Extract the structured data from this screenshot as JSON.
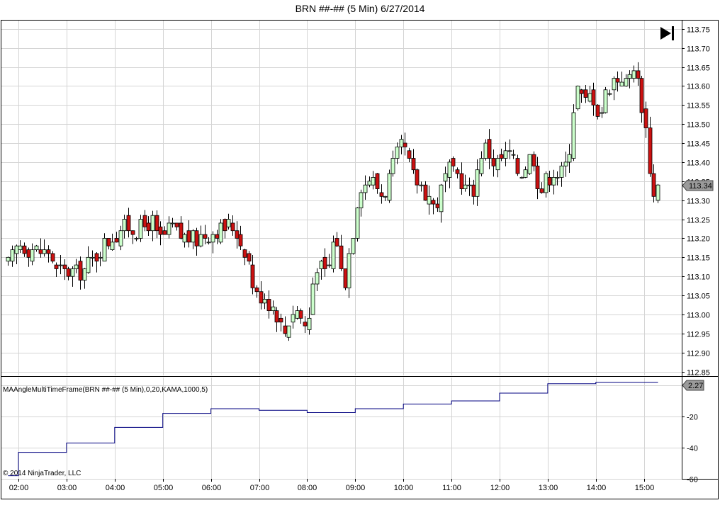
{
  "window": {
    "title": "BRN ##-## (5 Min)  6/27/2014"
  },
  "toolbar": {
    "scroll_to_end_icon": "skip-to-end-icon"
  },
  "indicator": {
    "label": "MAAngleMultiTimeFrame(BRN ##-## (5 Min),0,20,KAMA,1000,5)",
    "current_value_label": "2.27"
  },
  "price_panel": {
    "current_price_label": "113.34"
  },
  "copyright": "© 2014 NinjaTrader, LLC",
  "colors": {
    "up_candle": "#ccffcc",
    "down_candle": "#cc1111",
    "indicator_line": "#000080",
    "grid": "#d4d4d4"
  },
  "chart_data": [
    {
      "type": "candlestick",
      "title": "BRN ##-## (5 Min)  6/27/2014",
      "ylim": [
        112.84,
        113.77
      ],
      "yticks": [
        113.75,
        113.7,
        113.65,
        113.6,
        113.55,
        113.5,
        113.45,
        113.4,
        113.35,
        113.3,
        113.25,
        113.2,
        113.15,
        113.1,
        113.05,
        113.0,
        112.95,
        112.9,
        112.85
      ],
      "x_tick_labels": [
        "02:00",
        "03:00",
        "04:00",
        "05:00",
        "06:00",
        "07:00",
        "08:00",
        "09:00",
        "10:00",
        "11:00",
        "12:00",
        "13:00",
        "14:00",
        "15:00"
      ],
      "last_price": 113.34,
      "grid": true,
      "close_path": [
        [
          "01:47",
          113.13
        ],
        [
          "02:00",
          113.19
        ],
        [
          "02:20",
          113.17
        ],
        [
          "02:40",
          113.16
        ],
        [
          "02:45",
          113.11
        ],
        [
          "03:00",
          113.11
        ],
        [
          "03:20",
          113.11
        ],
        [
          "03:40",
          113.17
        ],
        [
          "03:55",
          113.2
        ],
        [
          "04:10",
          113.23
        ],
        [
          "04:30",
          113.22
        ],
        [
          "04:45",
          113.25
        ],
        [
          "04:55",
          113.19
        ],
        [
          "05:10",
          113.23
        ],
        [
          "05:25",
          113.2
        ],
        [
          "05:45",
          113.2
        ],
        [
          "06:00",
          113.22
        ],
        [
          "06:15",
          113.22
        ],
        [
          "06:25",
          113.24
        ],
        [
          "06:45",
          113.16
        ],
        [
          "06:55",
          113.05
        ],
        [
          "07:05",
          113.05
        ],
        [
          "07:20",
          113.02
        ],
        [
          "07:30",
          112.95
        ],
        [
          "07:45",
          113.02
        ],
        [
          "08:00",
          112.96
        ],
        [
          "08:10",
          113.14
        ],
        [
          "08:25",
          113.1
        ],
        [
          "08:35",
          113.22
        ],
        [
          "08:45",
          113.07
        ],
        [
          "08:55",
          113.2
        ],
        [
          "09:05",
          113.34
        ],
        [
          "09:20",
          113.36
        ],
        [
          "09:35",
          113.31
        ],
        [
          "09:50",
          113.41
        ],
        [
          "10:00",
          113.45
        ],
        [
          "10:10",
          113.37
        ],
        [
          "10:25",
          113.33
        ],
        [
          "10:40",
          113.28
        ],
        [
          "10:55",
          113.38
        ],
        [
          "11:10",
          113.36
        ],
        [
          "11:25",
          113.31
        ],
        [
          "11:40",
          113.45
        ],
        [
          "11:55",
          113.39
        ],
        [
          "12:10",
          113.43
        ],
        [
          "12:25",
          113.37
        ],
        [
          "12:40",
          113.43
        ],
        [
          "12:50",
          113.32
        ],
        [
          "13:05",
          113.38
        ],
        [
          "13:15",
          113.36
        ],
        [
          "13:25",
          113.4
        ],
        [
          "13:35",
          113.6
        ],
        [
          "13:45",
          113.55
        ],
        [
          "13:55",
          113.58
        ],
        [
          "14:05",
          113.52
        ],
        [
          "14:15",
          113.6
        ],
        [
          "14:30",
          113.63
        ],
        [
          "14:40",
          113.6
        ],
        [
          "14:45",
          113.68
        ],
        [
          "14:55",
          113.58
        ],
        [
          "15:05",
          113.45
        ],
        [
          "15:10",
          113.3
        ],
        [
          "15:17",
          113.34
        ]
      ]
    },
    {
      "type": "line",
      "title": "MAAngleMultiTimeFrame(BRN ##-## (5 Min),0,20,KAMA,1000,5)",
      "ylim": [
        -60,
        5
      ],
      "yticks": [
        0,
        -20,
        -40,
        -60
      ],
      "last_value": 2.27,
      "grid": true,
      "series": [
        {
          "steps": [
            [
              "01:47",
              -58
            ],
            [
              "02:00",
              -43
            ],
            [
              "03:00",
              -37
            ],
            [
              "04:00",
              -27
            ],
            [
              "05:00",
              -18
            ],
            [
              "06:00",
              -15
            ],
            [
              "07:00",
              -16
            ],
            [
              "08:00",
              -17.5
            ],
            [
              "09:00",
              -15
            ],
            [
              "10:00",
              -12
            ],
            [
              "11:00",
              -10
            ],
            [
              "12:00",
              -5
            ],
            [
              "13:00",
              1
            ],
            [
              "14:00",
              2
            ],
            [
              "15:17",
              2.27
            ]
          ]
        }
      ]
    }
  ]
}
